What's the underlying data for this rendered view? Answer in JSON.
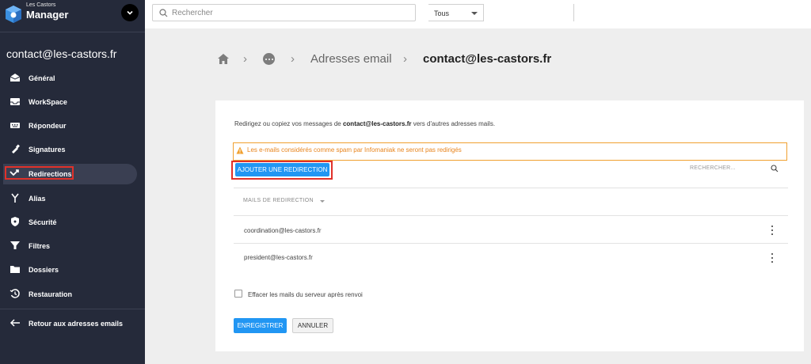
{
  "colors": {
    "sidebar_bg": "#252a3a",
    "accent_blue": "#2196f3",
    "warning_orange": "#e8841c",
    "highlight_red": "#e0312a"
  },
  "brand": {
    "top": "Les Castors",
    "main": "Manager",
    "logo_icon": "cube-logo-icon",
    "toggle_icon": "chevron-down-icon"
  },
  "search": {
    "placeholder": "Rechercher",
    "scope": "Tous"
  },
  "sidebar": {
    "account": "contact@les-castors.fr",
    "items": [
      {
        "label": "Général",
        "icon": "envelope-open-icon"
      },
      {
        "label": "WorkSpace",
        "icon": "inbox-icon"
      },
      {
        "label": "Répondeur",
        "icon": "keyboard-icon"
      },
      {
        "label": "Signatures",
        "icon": "pen-nib-icon"
      },
      {
        "label": "Redirections",
        "icon": "redirect-arrow-icon",
        "active": true
      },
      {
        "label": "Alias",
        "icon": "fork-icon"
      },
      {
        "label": "Sécurité",
        "icon": "shield-icon"
      },
      {
        "label": "Filtres",
        "icon": "funnel-icon"
      },
      {
        "label": "Dossiers",
        "icon": "folder-icon"
      },
      {
        "label": "Restauration",
        "icon": "history-icon"
      }
    ],
    "back": {
      "label": "Retour aux adresses emails",
      "icon": "arrow-left-icon"
    }
  },
  "breadcrumb": {
    "home_icon": "home-icon",
    "more_icon": "more-horizontal-icon",
    "section": "Adresses email",
    "current": "contact@les-castors.fr"
  },
  "card": {
    "intro_prefix": "Redirigez ou copiez vos messages de ",
    "intro_address": "contact@les-castors.fr",
    "intro_suffix": " vers d'autres adresses mails.",
    "warning": "Les e-mails considérés comme spam par Infomaniak ne seront pas redirigés",
    "add_button": "AJOUTER UNE REDIRECTION",
    "search_placeholder": "RECHERCHER...",
    "column_header": "MAILS DE REDIRECTION",
    "redirections": [
      {
        "email": "coordination@les-castors.fr"
      },
      {
        "email": "president@les-castors.fr"
      }
    ],
    "checkbox_label": "Effacer les mails du serveur après renvoi",
    "checkbox_checked": false,
    "save_button": "ENREGISTRER",
    "cancel_button": "ANNULER"
  }
}
